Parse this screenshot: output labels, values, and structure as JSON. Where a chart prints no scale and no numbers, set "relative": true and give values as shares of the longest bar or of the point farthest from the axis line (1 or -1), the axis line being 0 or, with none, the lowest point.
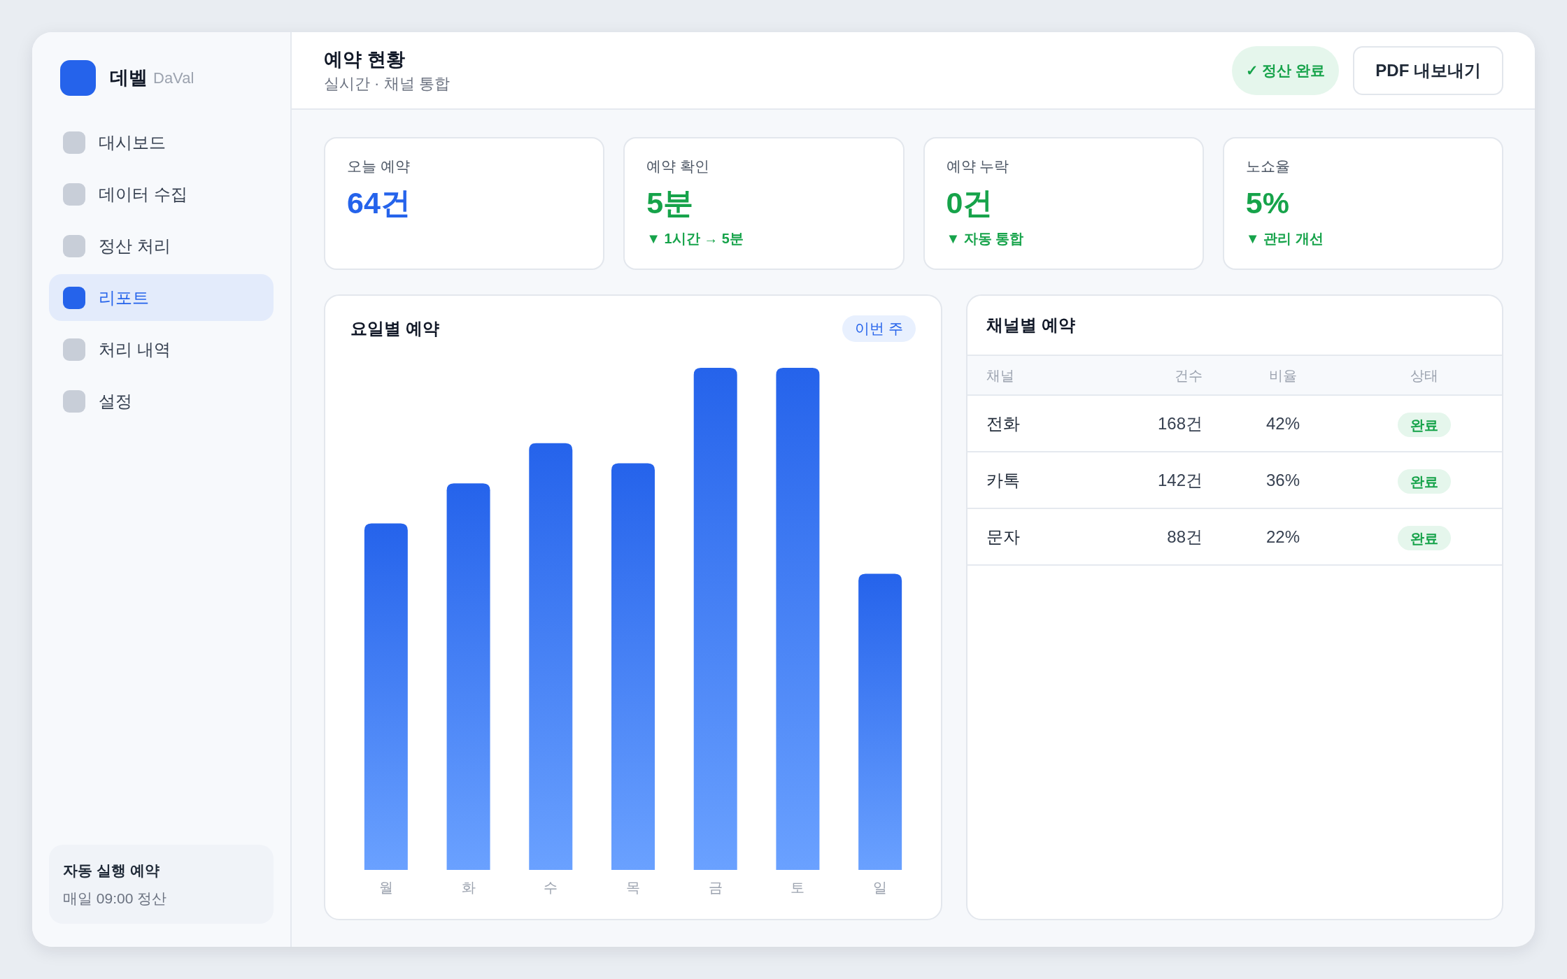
{
  "sidebar": {
    "brand": {
      "name": "데벨",
      "subtitle": "DaVal"
    },
    "items": [
      {
        "label": "대시보드",
        "selected": false
      },
      {
        "label": "데이터 수집",
        "selected": false
      },
      {
        "label": "정산 처리",
        "selected": false
      },
      {
        "label": "리포트",
        "selected": true
      },
      {
        "label": "처리 내역",
        "selected": false
      },
      {
        "label": "설정",
        "selected": false
      }
    ],
    "schedule_card": {
      "title": "자동 실행 예약",
      "detail": "매일 09:00 정산"
    }
  },
  "header": {
    "title": "예약 현황",
    "subtitle": "실시간 · 채널 통합",
    "status_badge": "✓ 정산 완료",
    "export_button": "PDF 내보내기"
  },
  "kpis": [
    {
      "label": "오늘 예약",
      "value": "64건",
      "color": "#2563eb"
    },
    {
      "label": "예약 확인",
      "value": "5분",
      "note": "▼ 1시간 → 5분",
      "color": "#16a34a"
    },
    {
      "label": "예약 누락",
      "value": "0건",
      "note": "▼ 자동 통합",
      "color": "#16a34a"
    },
    {
      "label": "노쇼율",
      "value": "5%",
      "note": "▼ 관리 개선",
      "color": "#16a34a"
    }
  ],
  "chart_panel": {
    "title": "요일별 예약",
    "range_badge": "이번 주",
    "chart_data": {
      "type": "bar",
      "relative": true,
      "categories": [
        "월",
        "화",
        "수",
        "목",
        "금",
        "토",
        "일"
      ],
      "values": [
        0.69,
        0.77,
        0.85,
        0.81,
        1,
        1,
        0.59
      ]
    }
  },
  "channel_table": {
    "title": "채널별 예약",
    "columns": [
      "채널",
      "건수",
      "비율",
      "상태"
    ],
    "rows": [
      {
        "channel": "전화",
        "count": "168건",
        "share": "42%",
        "status": "완료"
      },
      {
        "channel": "카톡",
        "count": "142건",
        "share": "36%",
        "status": "완료"
      },
      {
        "channel": "문자",
        "count": "88건",
        "share": "22%",
        "status": "완료"
      }
    ]
  }
}
